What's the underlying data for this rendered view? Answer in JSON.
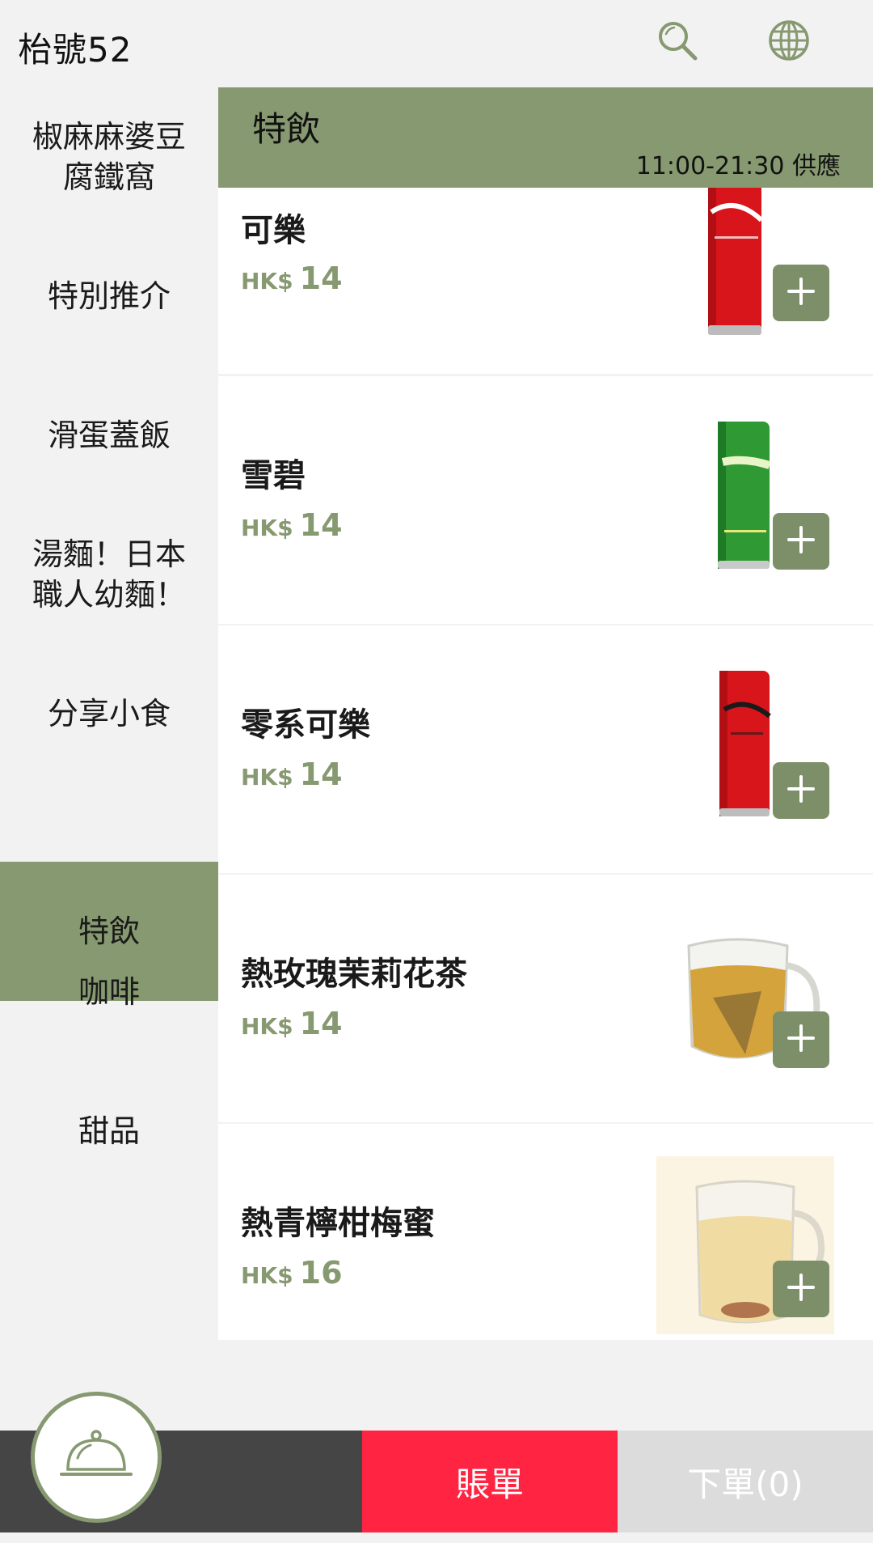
{
  "header": {
    "title": "枱號52"
  },
  "icons": {
    "search": "search-icon",
    "globe": "globe-icon",
    "cloche": "cloche-icon",
    "plus": "plus-icon"
  },
  "colors": {
    "accent": "#879970",
    "bill": "#ff2442",
    "dark_bar": "#454545",
    "order_bar": "#dcdcdc"
  },
  "sidebar": {
    "active_index": 5,
    "items": [
      {
        "label": "椒麻麻婆豆腐鐵窩"
      },
      {
        "label": "特別推介"
      },
      {
        "label": "滑蛋蓋飯"
      },
      {
        "label": "湯麵！日本職人幼麵！"
      },
      {
        "label": "分享小食"
      },
      {
        "label": "特飲"
      },
      {
        "label": "咖啡"
      },
      {
        "label": "甜品"
      }
    ]
  },
  "category": {
    "title": "特飲",
    "hours": "11:00-21:30 供應"
  },
  "products": [
    {
      "name": "可樂",
      "currency": "HK$",
      "price": "14"
    },
    {
      "name": "雪碧",
      "currency": "HK$",
      "price": "14"
    },
    {
      "name": "零系可樂",
      "currency": "HK$",
      "price": "14"
    },
    {
      "name": "熱玫瑰茉莉花茶",
      "currency": "HK$",
      "price": "14"
    },
    {
      "name": "熱青檸柑梅蜜",
      "currency": "HK$",
      "price": "16"
    }
  ],
  "bottom": {
    "bill_label": "賬單",
    "order_label": "下單(0)"
  }
}
